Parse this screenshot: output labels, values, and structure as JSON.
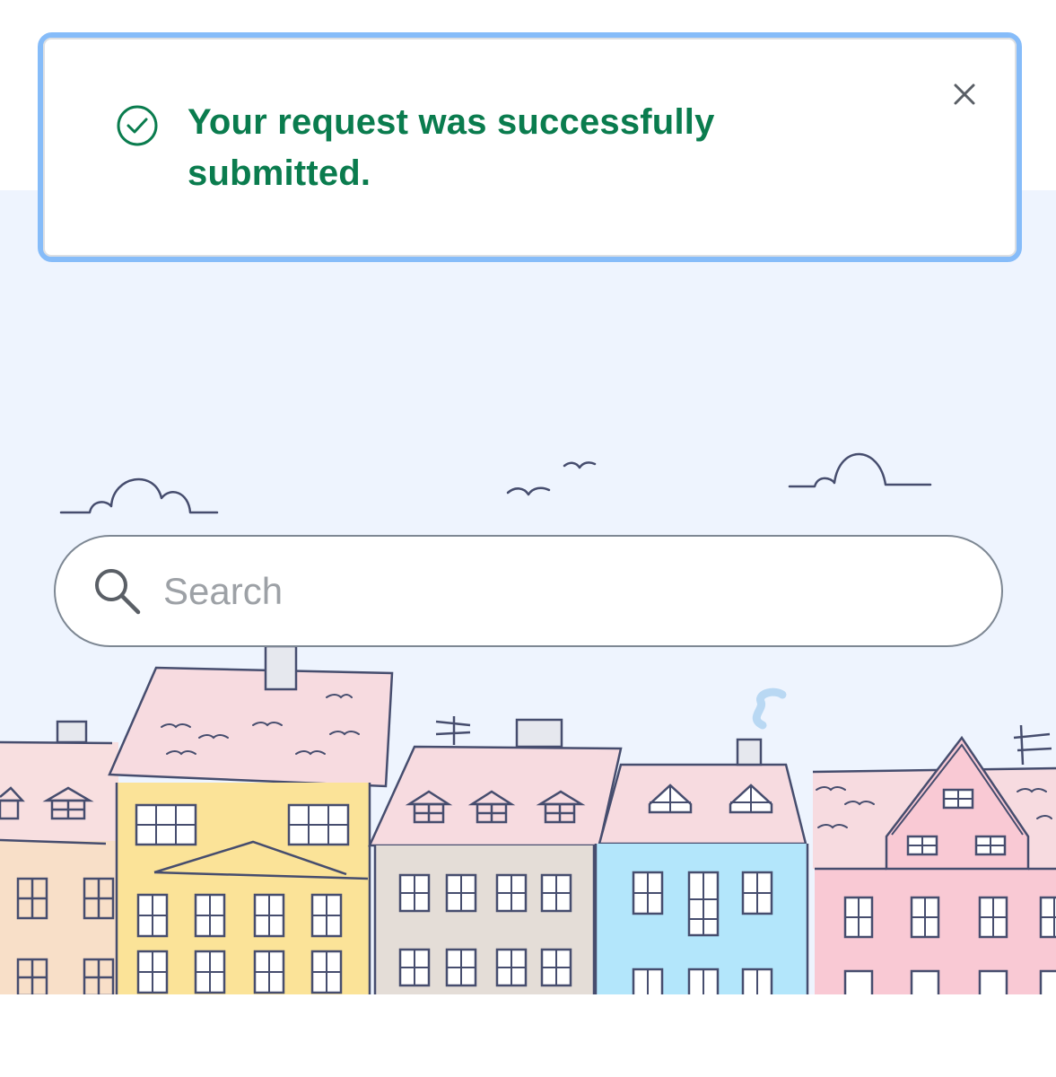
{
  "toast": {
    "message": "Your request was successfully submitted.",
    "status": "success",
    "icon": "check-circle-icon",
    "close_icon": "close-icon",
    "accent_color": "#0a7c4e",
    "border_color": "#86bcf9"
  },
  "search": {
    "placeholder": "Search",
    "value": "",
    "icon": "search-icon"
  },
  "hero": {
    "background_color": "#eef4fe",
    "illustration": "townhouses-illustration"
  }
}
